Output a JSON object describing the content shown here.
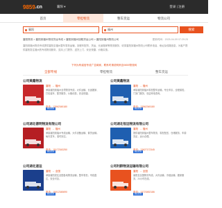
{
  "header": {
    "logo_main": "9859",
    "logo_suffix": ".cn",
    "city": "襄阳 ▾",
    "login": "登录 | 注册"
  },
  "nav": {
    "items": [
      {
        "label": "首页",
        "active": false
      },
      {
        "label": "零担物流",
        "active": true
      },
      {
        "label": "整车货运",
        "active": false
      },
      {
        "label": "物流公司",
        "active": false
      }
    ]
  },
  "search": {
    "from_value": "襄阳",
    "to_value": "福州",
    "button": "搜索"
  },
  "breadcrumb": {
    "path": "襄阳物流 > 襄阳到福州物流货运专线 > 襄阳到福州回程货运公司 > 襄阳到福州物流公司",
    "time": "更新时间：2025-04-09 07:29:25"
  },
  "intro": {
    "text": "襄阳到福州物流专线提供襄阳至福州整车零担运输、回程车配货、货运、长途搬家等物流服务，收录襄阳到福州物流公司联系电话、地址及线路信息，为客户提供襄阳发往福州的专线物流服务，支持上门提货、送货上门，安全快捷，价格实惠。"
  },
  "notice": "下列为有诚信专线广告商家，联系时请说明来自9859物流网",
  "tabs": [
    {
      "label": "全部专线",
      "active": true
    },
    {
      "label": "零担物流",
      "active": false
    },
    {
      "label": "整车货运",
      "active": false
    }
  ],
  "cards": [
    {
      "title": "公司黄鑫物流",
      "from": "襄阳",
      "to": "福州",
      "desc": "承接襄阳到福州全境物流专线，大件运输、长途搬家、打包装车、配货服务，价格优惠，安全快捷。",
      "phone": "电话：13562345180",
      "badge": "诚信商家",
      "thumb_color": "#c7272a",
      "thumb_text": "物流"
    },
    {
      "title": "公司黄鑫物流",
      "from": "襄阳",
      "to": "福州",
      "desc": "承接襄阳到福州零担整车运输，专业车队，全程保险，门到门服务，欢迎来电咨询。",
      "phone": "电话：13562345180",
      "badge": "诚信商家",
      "thumb_color": "#1f5fb0",
      "thumb_text": "货运"
    },
    {
      "title": "公司湖北德明物流有限公司",
      "from": "襄阳",
      "to": "福州",
      "desc": "承接襄阳到福州专线运输，大件设备运输、普货运输，每天发车，准时到达。",
      "phone": "电话：15172343250",
      "badge": "诚信商家",
      "thumb_color": "#b51e23",
      "thumb_text": "德明物流"
    },
    {
      "title": "公司湖北恒远物流有限公司",
      "from": "襄阳",
      "to": "福州",
      "desc": "提供襄阳到福州整车物流、零担配送、仓储服务，车源充足，运价合理。",
      "phone": "电话：13627172345",
      "badge": "诚信商家",
      "thumb_color": "#1f5fb0",
      "thumb_text": "恒远物流"
    },
    {
      "title": "公司湖北速运",
      "from": "襄阳",
      "to": "全国",
      "desc": "承接襄阳发往全国各地物流运输，整车零担，专线直达，安全可靠。",
      "phone": "电话：15012345690",
      "badge": "诚信商家",
      "thumb_color": "#1b3f8c",
      "thumb_text": "连邦 速运"
    },
    {
      "title": "公司利群物流运输有限公司",
      "from": "襄阳",
      "to": "全国",
      "desc": "襄阳至全国物流专线，大件运输、冷链运输、搬家服务，24小时在线。",
      "phone": "电话：13723452186",
      "badge": "诚信商家",
      "thumb_color": "#e8521f",
      "thumb_text": "物流"
    }
  ]
}
